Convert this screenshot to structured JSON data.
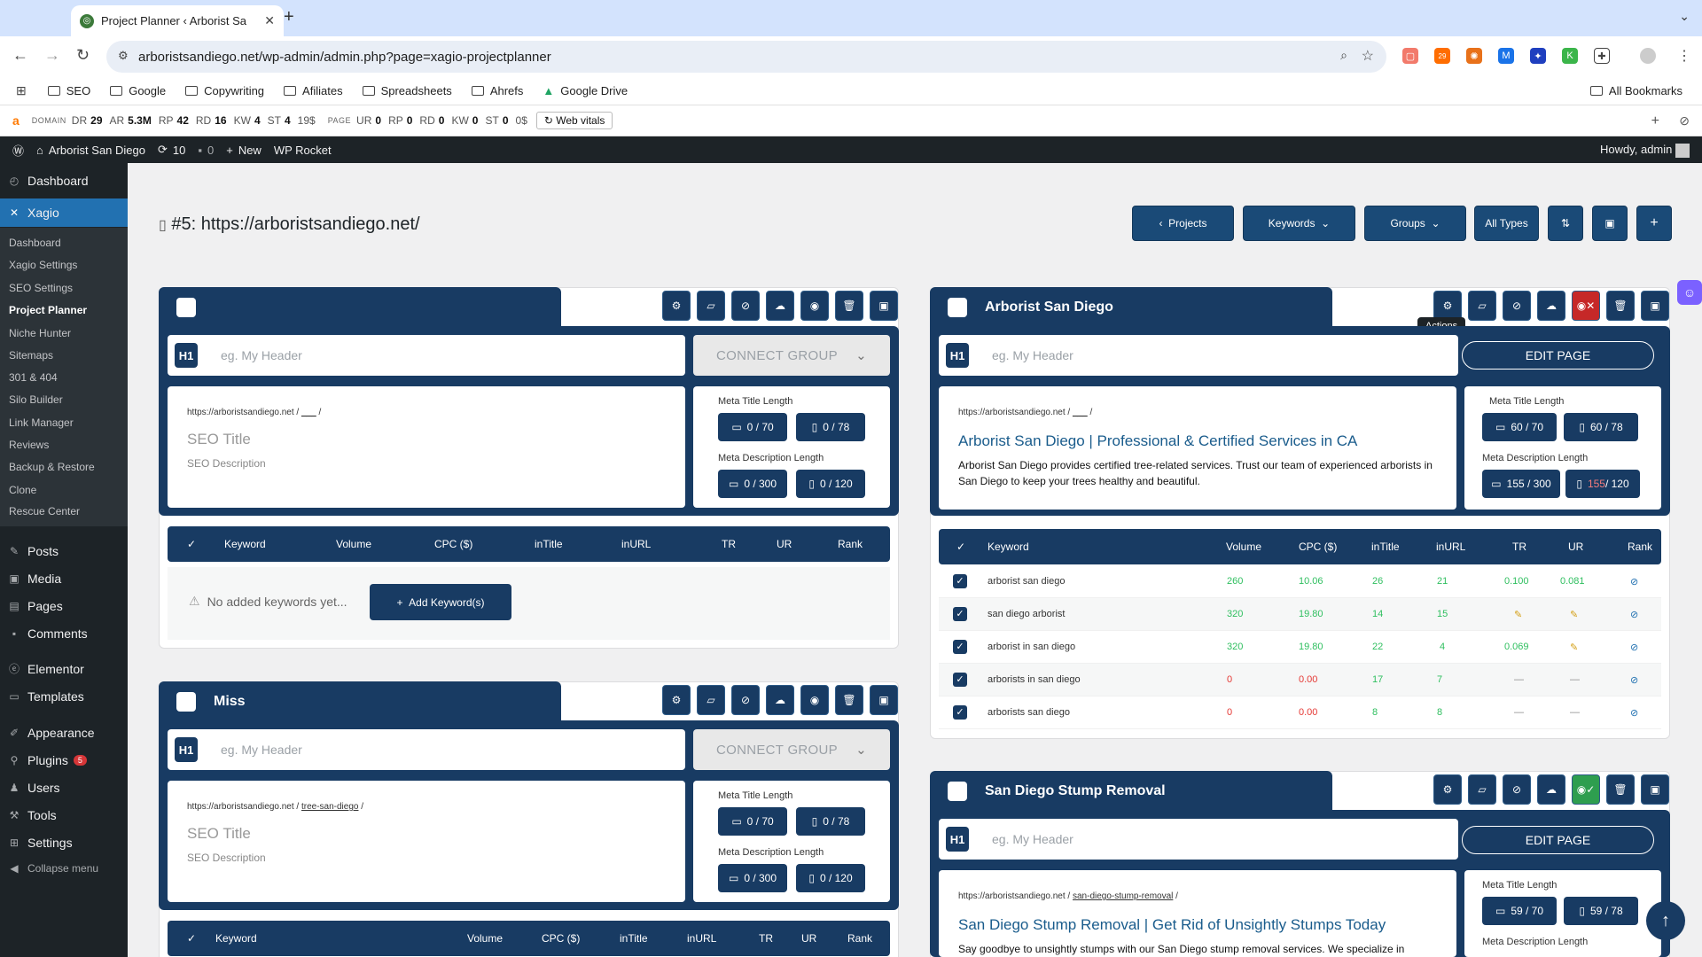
{
  "browser": {
    "tab_title": "Project Planner ‹ Arborist Sa",
    "url": "arboristsandiego.net/wp-admin/admin.php?page=xagio-projectplanner",
    "extension_badge": "29",
    "bookmarks": [
      "SEO",
      "Google",
      "Copywriting",
      "Afiliates",
      "Spreadsheets",
      "Ahrefs",
      "Google Drive"
    ],
    "all_bookmarks": "All Bookmarks"
  },
  "seo_toolbar": {
    "domain_label": "DOMAIN",
    "dr_label": "DR",
    "dr": "29",
    "ar_label": "AR",
    "ar": "5.3M",
    "rp_label": "RP",
    "rp": "42",
    "rd_label": "RD",
    "rd": "16",
    "kw_label": "KW",
    "kw": "4",
    "st_label": "ST",
    "st": "4",
    "st_value": "19$",
    "page_label": "PAGE",
    "ur_label": "UR",
    "ur": "0",
    "prp_label": "RP",
    "prp": "0",
    "prd_label": "RD",
    "prd": "0",
    "pkw_label": "KW",
    "pkw": "0",
    "pst_label": "ST",
    "pst": "0",
    "pst_value": "0$",
    "web_vitals": "Web vitals"
  },
  "adminbar": {
    "site": "Arborist San Diego",
    "updates": "10",
    "comments": "0",
    "new": "New",
    "rocket": "WP Rocket",
    "howdy": "Howdy, admin"
  },
  "sidebar": {
    "dashboard": "Dashboard",
    "xagio": "Xagio",
    "sub": [
      "Dashboard",
      "Xagio Settings",
      "SEO Settings",
      "Project Planner",
      "Niche Hunter",
      "Sitemaps",
      "301 & 404",
      "Silo Builder",
      "Link Manager",
      "Reviews",
      "Backup & Restore",
      "Clone",
      "Rescue Center"
    ],
    "posts": "Posts",
    "media": "Media",
    "pages": "Pages",
    "comments": "Comments",
    "elementor": "Elementor",
    "templates": "Templates",
    "appearance": "Appearance",
    "plugins": "Plugins",
    "plugins_badge": "5",
    "users": "Users",
    "tools": "Tools",
    "settings": "Settings",
    "collapse": "Collapse menu"
  },
  "page": {
    "title": "#5: https://arboristsandiego.net/",
    "buttons": {
      "projects": "Projects",
      "keywords": "Keywords",
      "groups": "Groups",
      "all_types": "All Types"
    }
  },
  "common": {
    "h1": "H1",
    "h1_placeholder": "eg. My Header",
    "connect_group": "CONNECT GROUP",
    "edit_page": "EDIT PAGE",
    "meta_title_length": "Meta Title Length",
    "meta_desc_length": "Meta Description Length",
    "seo_title_placeholder": "SEO Title",
    "seo_desc_placeholder": "SEO Description",
    "no_keywords": "No added keywords yet...",
    "add_keywords": "Add Keyword(s)",
    "tooltip_actions": "Actions",
    "columns": {
      "keyword": "Keyword",
      "volume": "Volume",
      "cpc": "CPC ($)",
      "intitle": "inTitle",
      "inurl": "inURL",
      "tr": "TR",
      "ur": "UR",
      "rank": "Rank"
    }
  },
  "groups": [
    {
      "name": "",
      "url_base": "https://arboristsandiego.net",
      "slug": "___",
      "meta_title": {
        "desktop": "0 / 70",
        "mobile": "0 / 78"
      },
      "meta_desc": {
        "desktop": "0 / 300",
        "mobile": "0 / 120"
      }
    },
    {
      "name": "Miss",
      "url_base": "https://arboristsandiego.net",
      "slug": "tree-san-diego",
      "meta_title": {
        "desktop": "0 / 70",
        "mobile": "0 / 78"
      },
      "meta_desc": {
        "desktop": "0 / 300",
        "mobile": "0 / 120"
      }
    },
    {
      "name": "Arborist San Diego",
      "url_base": "https://arboristsandiego.net",
      "slug": "___",
      "seo_title": "Arborist San Diego | Professional & Certified Services in CA",
      "seo_desc": "Arborist San Diego provides certified tree-related services. Trust our team of experienced arborists in San Diego to keep your trees healthy and beautiful.",
      "meta_title": {
        "desktop": "60 / 70",
        "mobile": "60 / 78"
      },
      "meta_desc": {
        "desktop": "155 / 300",
        "mobile_over": "155",
        "mobile_max": "/ 120"
      },
      "keywords": [
        {
          "keyword": "arborist san diego",
          "volume": "260",
          "cpc": "10.06",
          "intitle": "26",
          "inurl": "21",
          "tr": "0.100",
          "ur": "0.081"
        },
        {
          "keyword": "san diego arborist",
          "volume": "320",
          "cpc": "19.80",
          "intitle": "14",
          "inurl": "15",
          "tr": "✎",
          "ur": "✎"
        },
        {
          "keyword": "arborist in san diego",
          "volume": "320",
          "cpc": "19.80",
          "intitle": "22",
          "inurl": "4",
          "tr": "0.069",
          "ur": "✎"
        },
        {
          "keyword": "arborists in san diego",
          "volume": "0",
          "cpc": "0.00",
          "intitle": "17",
          "inurl": "7",
          "tr": "—",
          "ur": "—"
        },
        {
          "keyword": "arborists san diego",
          "volume": "0",
          "cpc": "0.00",
          "intitle": "8",
          "inurl": "8",
          "tr": "—",
          "ur": "—"
        }
      ]
    },
    {
      "name": "San Diego Stump Removal",
      "url_base": "https://arboristsandiego.net",
      "slug": "san-diego-stump-removal",
      "seo_title": "San Diego Stump Removal | Get Rid of Unsightly Stumps Today",
      "seo_desc": "Say goodbye to unsightly stumps with our San Diego stump removal services. We specialize in",
      "meta_title": {
        "desktop": "59 / 70",
        "mobile": "59 / 78"
      }
    }
  ]
}
